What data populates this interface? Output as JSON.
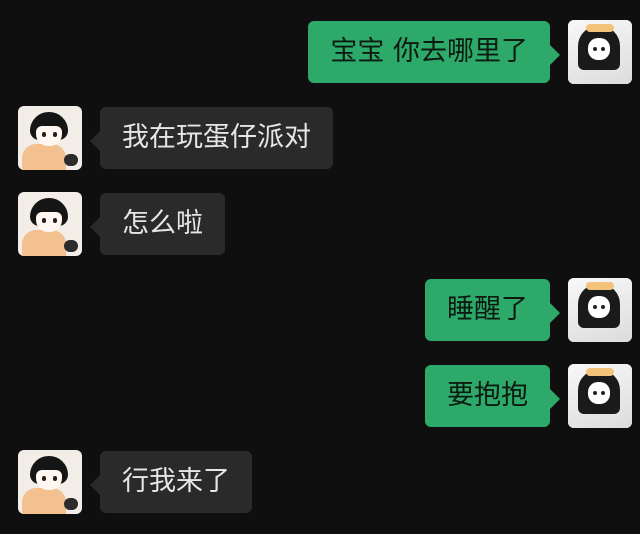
{
  "theme": {
    "background": "#0f0f0f",
    "incoming_bubble": "#2a2a2a",
    "incoming_text": "#e6e6e6",
    "outgoing_bubble": "#2daa6a",
    "outgoing_text": "#0d1a12"
  },
  "messages": [
    {
      "side": "right",
      "text": "宝宝 你去哪里了",
      "avatar": "girl-avatar"
    },
    {
      "side": "left",
      "text": "我在玩蛋仔派对",
      "avatar": "boy-avatar"
    },
    {
      "side": "left",
      "text": "怎么啦",
      "avatar": "boy-avatar"
    },
    {
      "side": "right",
      "text": "睡醒了",
      "avatar": "girl-avatar"
    },
    {
      "side": "right",
      "text": "要抱抱",
      "avatar": "girl-avatar"
    },
    {
      "side": "left",
      "text": "行我来了",
      "avatar": "boy-avatar"
    }
  ]
}
